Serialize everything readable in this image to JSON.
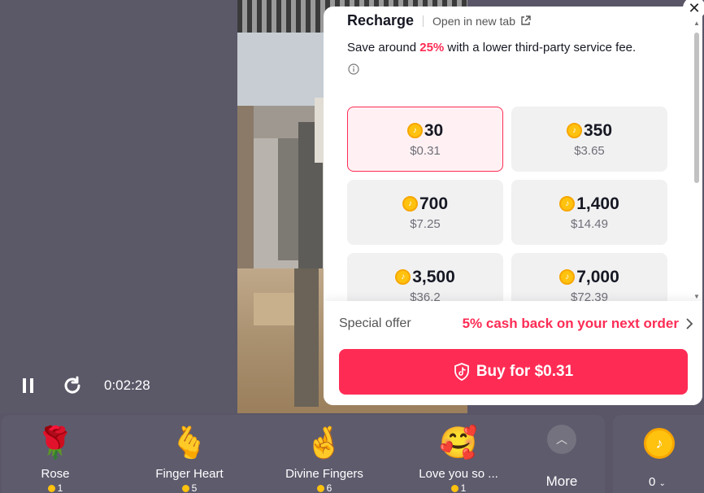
{
  "player": {
    "time": "0:02:28"
  },
  "recharge": {
    "title": "Recharge",
    "open_new_tab": "Open in new tab",
    "save_prefix": "Save around ",
    "save_pct": "25%",
    "save_suffix": " with a lower third-party service fee.",
    "packages": [
      {
        "coins": "30",
        "price": "$0.31",
        "selected": true
      },
      {
        "coins": "350",
        "price": "$3.65",
        "selected": false
      },
      {
        "coins": "700",
        "price": "$7.25",
        "selected": false
      },
      {
        "coins": "1,400",
        "price": "$14.49",
        "selected": false
      },
      {
        "coins": "3,500",
        "price": "$36.2",
        "selected": false
      },
      {
        "coins": "7,000",
        "price": "$72.39",
        "selected": false
      }
    ],
    "special_label": "Special offer",
    "special_offer": "5% cash back on your next order",
    "buy_label": "Buy for $0.31"
  },
  "gifts": [
    {
      "name": "Rose",
      "cost": "1",
      "icon": "rose-icon",
      "emoji": "🌹"
    },
    {
      "name": "Finger Heart",
      "cost": "5",
      "icon": "finger-heart-icon",
      "emoji": "🫰"
    },
    {
      "name": "Divine Fingers",
      "cost": "6",
      "icon": "divine-fingers-icon",
      "emoji": "🤞"
    },
    {
      "name": "Love you so ...",
      "cost": "1",
      "icon": "love-you-icon",
      "emoji": "🥰"
    }
  ],
  "more_label": "More",
  "wallet": {
    "balance": "0"
  },
  "colors": {
    "accent": "#fe2c55",
    "coin": "#ffc20e"
  }
}
